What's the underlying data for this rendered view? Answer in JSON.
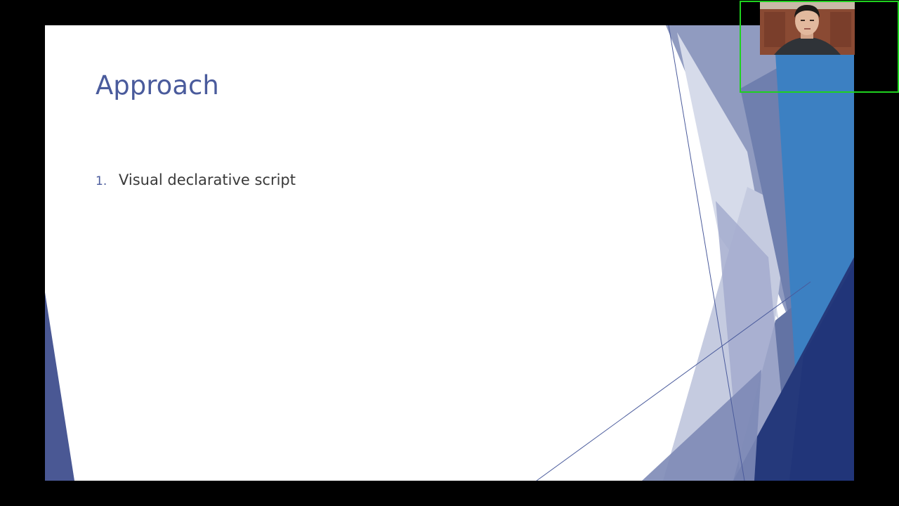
{
  "slide": {
    "title": "Approach",
    "bullets": [
      {
        "number": "1.",
        "text": "Visual declarative script"
      }
    ]
  },
  "colors": {
    "background": "#000000",
    "slide_background": "#ffffff",
    "title": "#4a5b9c",
    "body_text": "#3a3a3a",
    "accent_dark": "#26397a",
    "accent_blue": "#3a7fc0",
    "webcam_border": "#1fd11f"
  },
  "webcam": {
    "icon": "presenter-video-feed"
  }
}
